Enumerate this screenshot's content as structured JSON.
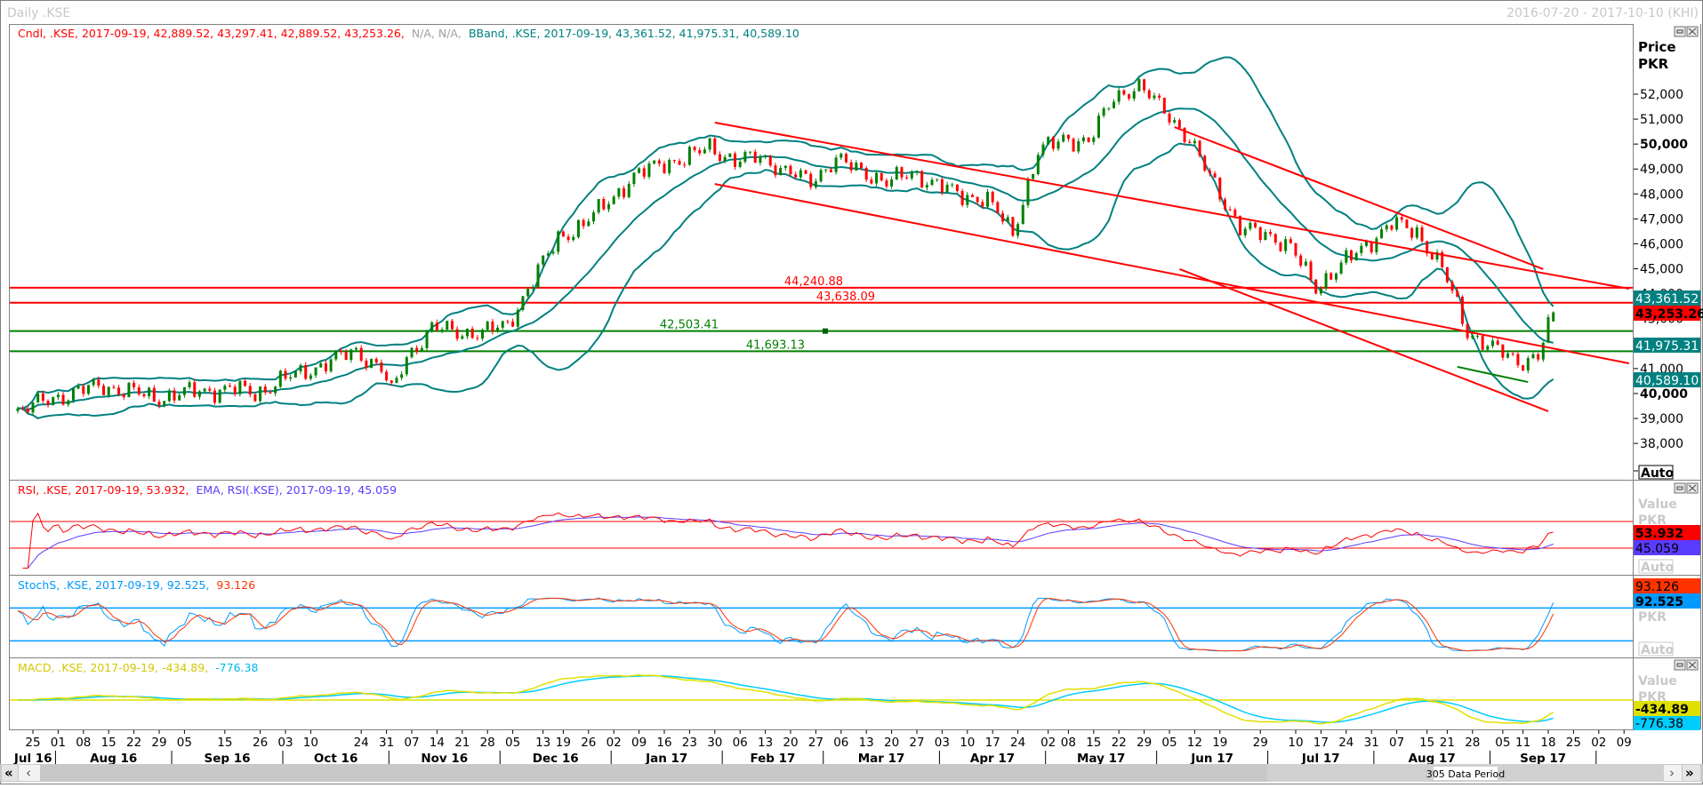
{
  "window": {
    "title": "Daily .KSE",
    "date_range": "2016-07-20 - 2017-10-10 (KHI)"
  },
  "main_pane": {
    "legend": {
      "candle": "Cndl, .KSE, 2017-09-19, 42,889.52, 43,297.41, 42,889.52, 43,253.26,",
      "na": "N/A, N/A,",
      "bband": "BBand, .KSE, 2017-09-19, 43,361.52, 41,975.31, 40,589.10"
    },
    "axis_title": "Price",
    "axis_unit": "PKR",
    "auto_label": "Auto",
    "value_boxes": {
      "bb_upper": "43,361.52",
      "last": "43,253.26",
      "bb_mid": "41,975.31",
      "bb_lower": "40,589.10"
    },
    "hlines": [
      {
        "label": "44,240.88",
        "value": 44240.88,
        "color": "#ff0000"
      },
      {
        "label": "43,638.09",
        "value": 43638.09,
        "color": "#ff0000"
      },
      {
        "label": "42,503.41",
        "value": 42503.41,
        "color": "#008000"
      },
      {
        "label": "41,693.13",
        "value": 41693.13,
        "color": "#008000"
      }
    ]
  },
  "rsi_pane": {
    "legend_rsi": "RSI, .KSE, 2017-09-19, 53.932,",
    "legend_ema": "EMA, RSI(.KSE), 2017-09-19, 45.059",
    "axis_title": "Value",
    "axis_unit": "PKR",
    "auto_label": "Auto",
    "rsi_value": "53.932",
    "ema_value": "45.059",
    "levels": [
      70,
      30
    ]
  },
  "stoch_pane": {
    "legend_k": "StochS, .KSE, 2017-09-19, 92.525,",
    "legend_d": "93.126",
    "axis_unit": "PKR",
    "auto_label": "Auto",
    "d_value": "93.126",
    "k_value": "92.525",
    "levels": [
      80,
      20
    ]
  },
  "macd_pane": {
    "legend_macd": "MACD, .KSE, 2017-09-19, -434.89,",
    "legend_signal": "-776.38",
    "axis_title": "Value",
    "axis_unit": "PKR",
    "macd_value": "-434.89",
    "signal_value": "-776.38"
  },
  "scrollbar": {
    "label": "305 Data Period",
    "first": "«",
    "prev": "‹",
    "next": "›",
    "last": "»"
  },
  "colors": {
    "up": "#008000",
    "down": "#ff0000",
    "bband": "#008080",
    "trend": "#ff0000",
    "support": "#008000",
    "rsi": "#ff0000",
    "ema": "#5a3cff",
    "stoch_k": "#0099ff",
    "stoch_d": "#ff3300",
    "macd": "#e0e000",
    "signal": "#00ccff"
  },
  "chart_data": {
    "type": "candlestick",
    "symbol": ".KSE",
    "period": "Daily",
    "xlim": [
      "2016-07-20",
      "2017-10-10"
    ],
    "ylim": [
      37300,
      53700
    ],
    "y_ticks": [
      {
        "value": 38000,
        "label": "38,000"
      },
      {
        "value": 39000,
        "label": "39,000"
      },
      {
        "value": 40000,
        "label": "40,000",
        "bold": true
      },
      {
        "value": 41000,
        "label": "41,000"
      },
      {
        "value": 42000,
        "label": "42,000"
      },
      {
        "value": 43000,
        "label": "43,000"
      },
      {
        "value": 44000,
        "label": "44,000"
      },
      {
        "value": 45000,
        "label": "45,000"
      },
      {
        "value": 46000,
        "label": "46,000"
      },
      {
        "value": 47000,
        "label": "47,000"
      },
      {
        "value": 48000,
        "label": "48,000"
      },
      {
        "value": 49000,
        "label": "49,000"
      },
      {
        "value": 50000,
        "label": "50,000",
        "bold": true
      },
      {
        "value": 51000,
        "label": "51,000"
      },
      {
        "value": 52000,
        "label": "52,000"
      }
    ],
    "last_candle": {
      "date": "2017-09-19",
      "open": 42889.52,
      "high": 43297.41,
      "low": 42889.52,
      "close": 43253.26
    },
    "close_path": [
      [
        "2016-07-20",
        39300
      ],
      [
        "2016-07-29",
        39800
      ],
      [
        "2016-08-05",
        40100
      ],
      [
        "2016-08-12",
        40300
      ],
      [
        "2016-08-19",
        40100
      ],
      [
        "2016-08-26",
        39800
      ],
      [
        "2016-09-02",
        40000
      ],
      [
        "2016-09-09",
        40100
      ],
      [
        "2016-09-16",
        40200
      ],
      [
        "2016-09-23",
        40000
      ],
      [
        "2016-09-30",
        40500
      ],
      [
        "2016-10-07",
        40900
      ],
      [
        "2016-10-14",
        41300
      ],
      [
        "2016-10-21",
        41700
      ],
      [
        "2016-10-28",
        41000
      ],
      [
        "2016-11-01",
        40000
      ],
      [
        "2016-11-04",
        41500
      ],
      [
        "2016-11-11",
        42600
      ],
      [
        "2016-11-18",
        42500
      ],
      [
        "2016-11-25",
        42400
      ],
      [
        "2016-12-02",
        42800
      ],
      [
        "2016-12-09",
        44500
      ],
      [
        "2016-12-16",
        46300
      ],
      [
        "2016-12-23",
        46700
      ],
      [
        "2016-12-30",
        47800
      ],
      [
        "2017-01-06",
        48600
      ],
      [
        "2017-01-13",
        49300
      ],
      [
        "2017-01-20",
        49300
      ],
      [
        "2017-01-27",
        50000
      ],
      [
        "2017-02-03",
        49200
      ],
      [
        "2017-02-10",
        49600
      ],
      [
        "2017-02-17",
        48800
      ],
      [
        "2017-02-24",
        48600
      ],
      [
        "2017-03-03",
        49300
      ],
      [
        "2017-03-10",
        49000
      ],
      [
        "2017-03-17",
        48400
      ],
      [
        "2017-03-24",
        48900
      ],
      [
        "2017-03-31",
        48300
      ],
      [
        "2017-04-07",
        48000
      ],
      [
        "2017-04-14",
        47700
      ],
      [
        "2017-04-21",
        46500
      ],
      [
        "2017-04-28",
        49600
      ],
      [
        "2017-05-05",
        50300
      ],
      [
        "2017-05-12",
        50000
      ],
      [
        "2017-05-19",
        52000
      ],
      [
        "2017-05-26",
        52200
      ],
      [
        "2017-06-02",
        51500
      ],
      [
        "2017-06-09",
        50000
      ],
      [
        "2017-06-16",
        48500
      ],
      [
        "2017-06-23",
        46500
      ],
      [
        "2017-06-30",
        46500
      ],
      [
        "2017-07-07",
        45800
      ],
      [
        "2017-07-14",
        44300
      ],
      [
        "2017-07-21",
        45100
      ],
      [
        "2017-07-28",
        46000
      ],
      [
        "2017-08-04",
        46800
      ],
      [
        "2017-08-11",
        46500
      ],
      [
        "2017-08-18",
        45000
      ],
      [
        "2017-08-25",
        42500
      ],
      [
        "2017-09-01",
        41800
      ],
      [
        "2017-09-08",
        41300
      ],
      [
        "2017-09-14",
        41500
      ],
      [
        "2017-09-19",
        43253.26
      ]
    ],
    "trendlines": [
      {
        "from": [
          "2017-01-30",
          50860
        ],
        "to": [
          "2017-10-10",
          44200
        ],
        "color": "#ff0000"
      },
      {
        "from": [
          "2017-01-30",
          48400
        ],
        "to": [
          "2017-10-10",
          41210
        ],
        "color": "#ff0000"
      },
      {
        "from": [
          "2017-06-06",
          50680
        ],
        "to": [
          "2017-09-15",
          44985
        ],
        "color": "#ff0000"
      },
      {
        "from": [
          "2017-06-07",
          44985
        ],
        "to": [
          "2017-09-18",
          39290
        ],
        "color": "#ff0000"
      },
      {
        "from": [
          "2017-08-23",
          41070
        ],
        "to": [
          "2017-09-12",
          40460
        ],
        "color": "#008000"
      }
    ],
    "x_ticks": [
      [
        "2016-07-25",
        "25"
      ],
      [
        "2016-08-01",
        "01"
      ],
      [
        "2016-08-08",
        "08"
      ],
      [
        "2016-08-15",
        "15"
      ],
      [
        "2016-08-22",
        "22"
      ],
      [
        "2016-08-29",
        "29"
      ],
      [
        "2016-09-05",
        "05"
      ],
      [
        "2016-09-15",
        "15"
      ],
      [
        "2016-09-26",
        "26"
      ],
      [
        "2016-10-03",
        "03"
      ],
      [
        "2016-10-10",
        "10"
      ],
      [
        "2016-10-24",
        "24"
      ],
      [
        "2016-10-31",
        "31"
      ],
      [
        "2016-11-07",
        "07"
      ],
      [
        "2016-11-14",
        "14"
      ],
      [
        "2016-11-21",
        "21"
      ],
      [
        "2016-11-28",
        "28"
      ],
      [
        "2016-12-05",
        "05"
      ],
      [
        "2016-12-13",
        "13"
      ],
      [
        "2016-12-19",
        "19"
      ],
      [
        "2016-12-26",
        "26"
      ],
      [
        "2017-01-02",
        "02"
      ],
      [
        "2017-01-09",
        "09"
      ],
      [
        "2017-01-16",
        "16"
      ],
      [
        "2017-01-23",
        "23"
      ],
      [
        "2017-01-30",
        "30"
      ],
      [
        "2017-02-06",
        "06"
      ],
      [
        "2017-02-13",
        "13"
      ],
      [
        "2017-02-20",
        "20"
      ],
      [
        "2017-02-27",
        "27"
      ],
      [
        "2017-03-06",
        "06"
      ],
      [
        "2017-03-13",
        "13"
      ],
      [
        "2017-03-20",
        "20"
      ],
      [
        "2017-03-27",
        "27"
      ],
      [
        "2017-04-03",
        "03"
      ],
      [
        "2017-04-10",
        "10"
      ],
      [
        "2017-04-17",
        "17"
      ],
      [
        "2017-04-24",
        "24"
      ],
      [
        "2017-05-02",
        "02"
      ],
      [
        "2017-05-08",
        "08"
      ],
      [
        "2017-05-15",
        "15"
      ],
      [
        "2017-05-22",
        "22"
      ],
      [
        "2017-05-29",
        "29"
      ],
      [
        "2017-06-05",
        "05"
      ],
      [
        "2017-06-12",
        "12"
      ],
      [
        "2017-06-19",
        "19"
      ],
      [
        "2017-06-29",
        "29"
      ],
      [
        "2017-07-10",
        "10"
      ],
      [
        "2017-07-17",
        "17"
      ],
      [
        "2017-07-24",
        "24"
      ],
      [
        "2017-07-31",
        "31"
      ],
      [
        "2017-08-07",
        "07"
      ],
      [
        "2017-08-15",
        "15"
      ],
      [
        "2017-08-21",
        "21"
      ],
      [
        "2017-08-28",
        "28"
      ],
      [
        "2017-09-05",
        "05"
      ],
      [
        "2017-09-11",
        "11"
      ],
      [
        "2017-09-18",
        "18"
      ],
      [
        "2017-09-25",
        "25"
      ],
      [
        "2017-10-02",
        "02"
      ],
      [
        "2017-10-09",
        "09"
      ]
    ],
    "months": [
      [
        "2016-07-20",
        "Jul 16"
      ],
      [
        "2016-08-01",
        "Aug 16"
      ],
      [
        "2016-09-01",
        "Sep 16"
      ],
      [
        "2016-10-03",
        "Oct 16"
      ],
      [
        "2016-11-01",
        "Nov 16"
      ],
      [
        "2016-12-01",
        "Dec 16"
      ],
      [
        "2017-01-02",
        "Jan 17"
      ],
      [
        "2017-02-01",
        "Feb 17"
      ],
      [
        "2017-03-01",
        "Mar 17"
      ],
      [
        "2017-04-03",
        "Apr 17"
      ],
      [
        "2017-05-02",
        "May 17"
      ],
      [
        "2017-06-01",
        "Jun 17"
      ],
      [
        "2017-07-03",
        "Jul 17"
      ],
      [
        "2017-08-01",
        "Aug 17"
      ],
      [
        "2017-09-01",
        "Sep 17"
      ],
      [
        "2017-10-02",
        ""
      ]
    ]
  }
}
